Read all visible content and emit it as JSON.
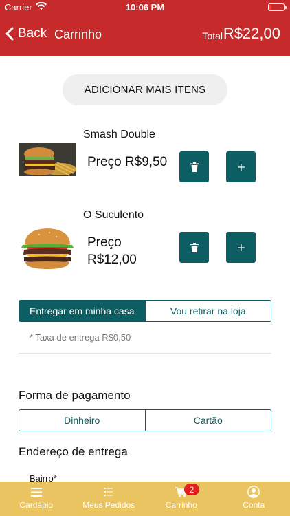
{
  "status_bar": {
    "carrier": "Carrier",
    "time": "10:06 PM"
  },
  "nav": {
    "back_label": "Back",
    "title": "Carrinho",
    "total_label": "Total",
    "total_value": "R$22,00"
  },
  "add_more_label": "ADICIONAR MAIS ITENS",
  "items": [
    {
      "name": "Smash Double",
      "price": "Preço R$9,50",
      "image": "smash-double-burger-with-fries"
    },
    {
      "name": "O Suculento",
      "price": "Preço R$12,00",
      "image": "o-suculento-burger"
    }
  ],
  "delivery": {
    "options": [
      "Entregar em minha casa",
      "Vou retirar na loja"
    ],
    "selected": "Entregar em minha casa",
    "fee_note": "* Taxa de entrega R$0,50"
  },
  "payment": {
    "title": "Forma de pagamento",
    "options": [
      "Dinheiro",
      "Cartão"
    ]
  },
  "address": {
    "title": "Endereço de entrega",
    "neighborhood_label": "Bairro*"
  },
  "tabbar": {
    "tabs": [
      {
        "label": "Cardápio",
        "icon": "menu-icon"
      },
      {
        "label": "Meus Pedidos",
        "icon": "list-icon"
      },
      {
        "label": "Carrinho",
        "icon": "cart-icon",
        "badge": "2"
      },
      {
        "label": "Conta",
        "icon": "account-icon"
      }
    ]
  },
  "colors": {
    "primary": "#c62a2a",
    "accent": "#0d5e63",
    "tabbar": "#e9c460",
    "badge": "#e0201d"
  }
}
